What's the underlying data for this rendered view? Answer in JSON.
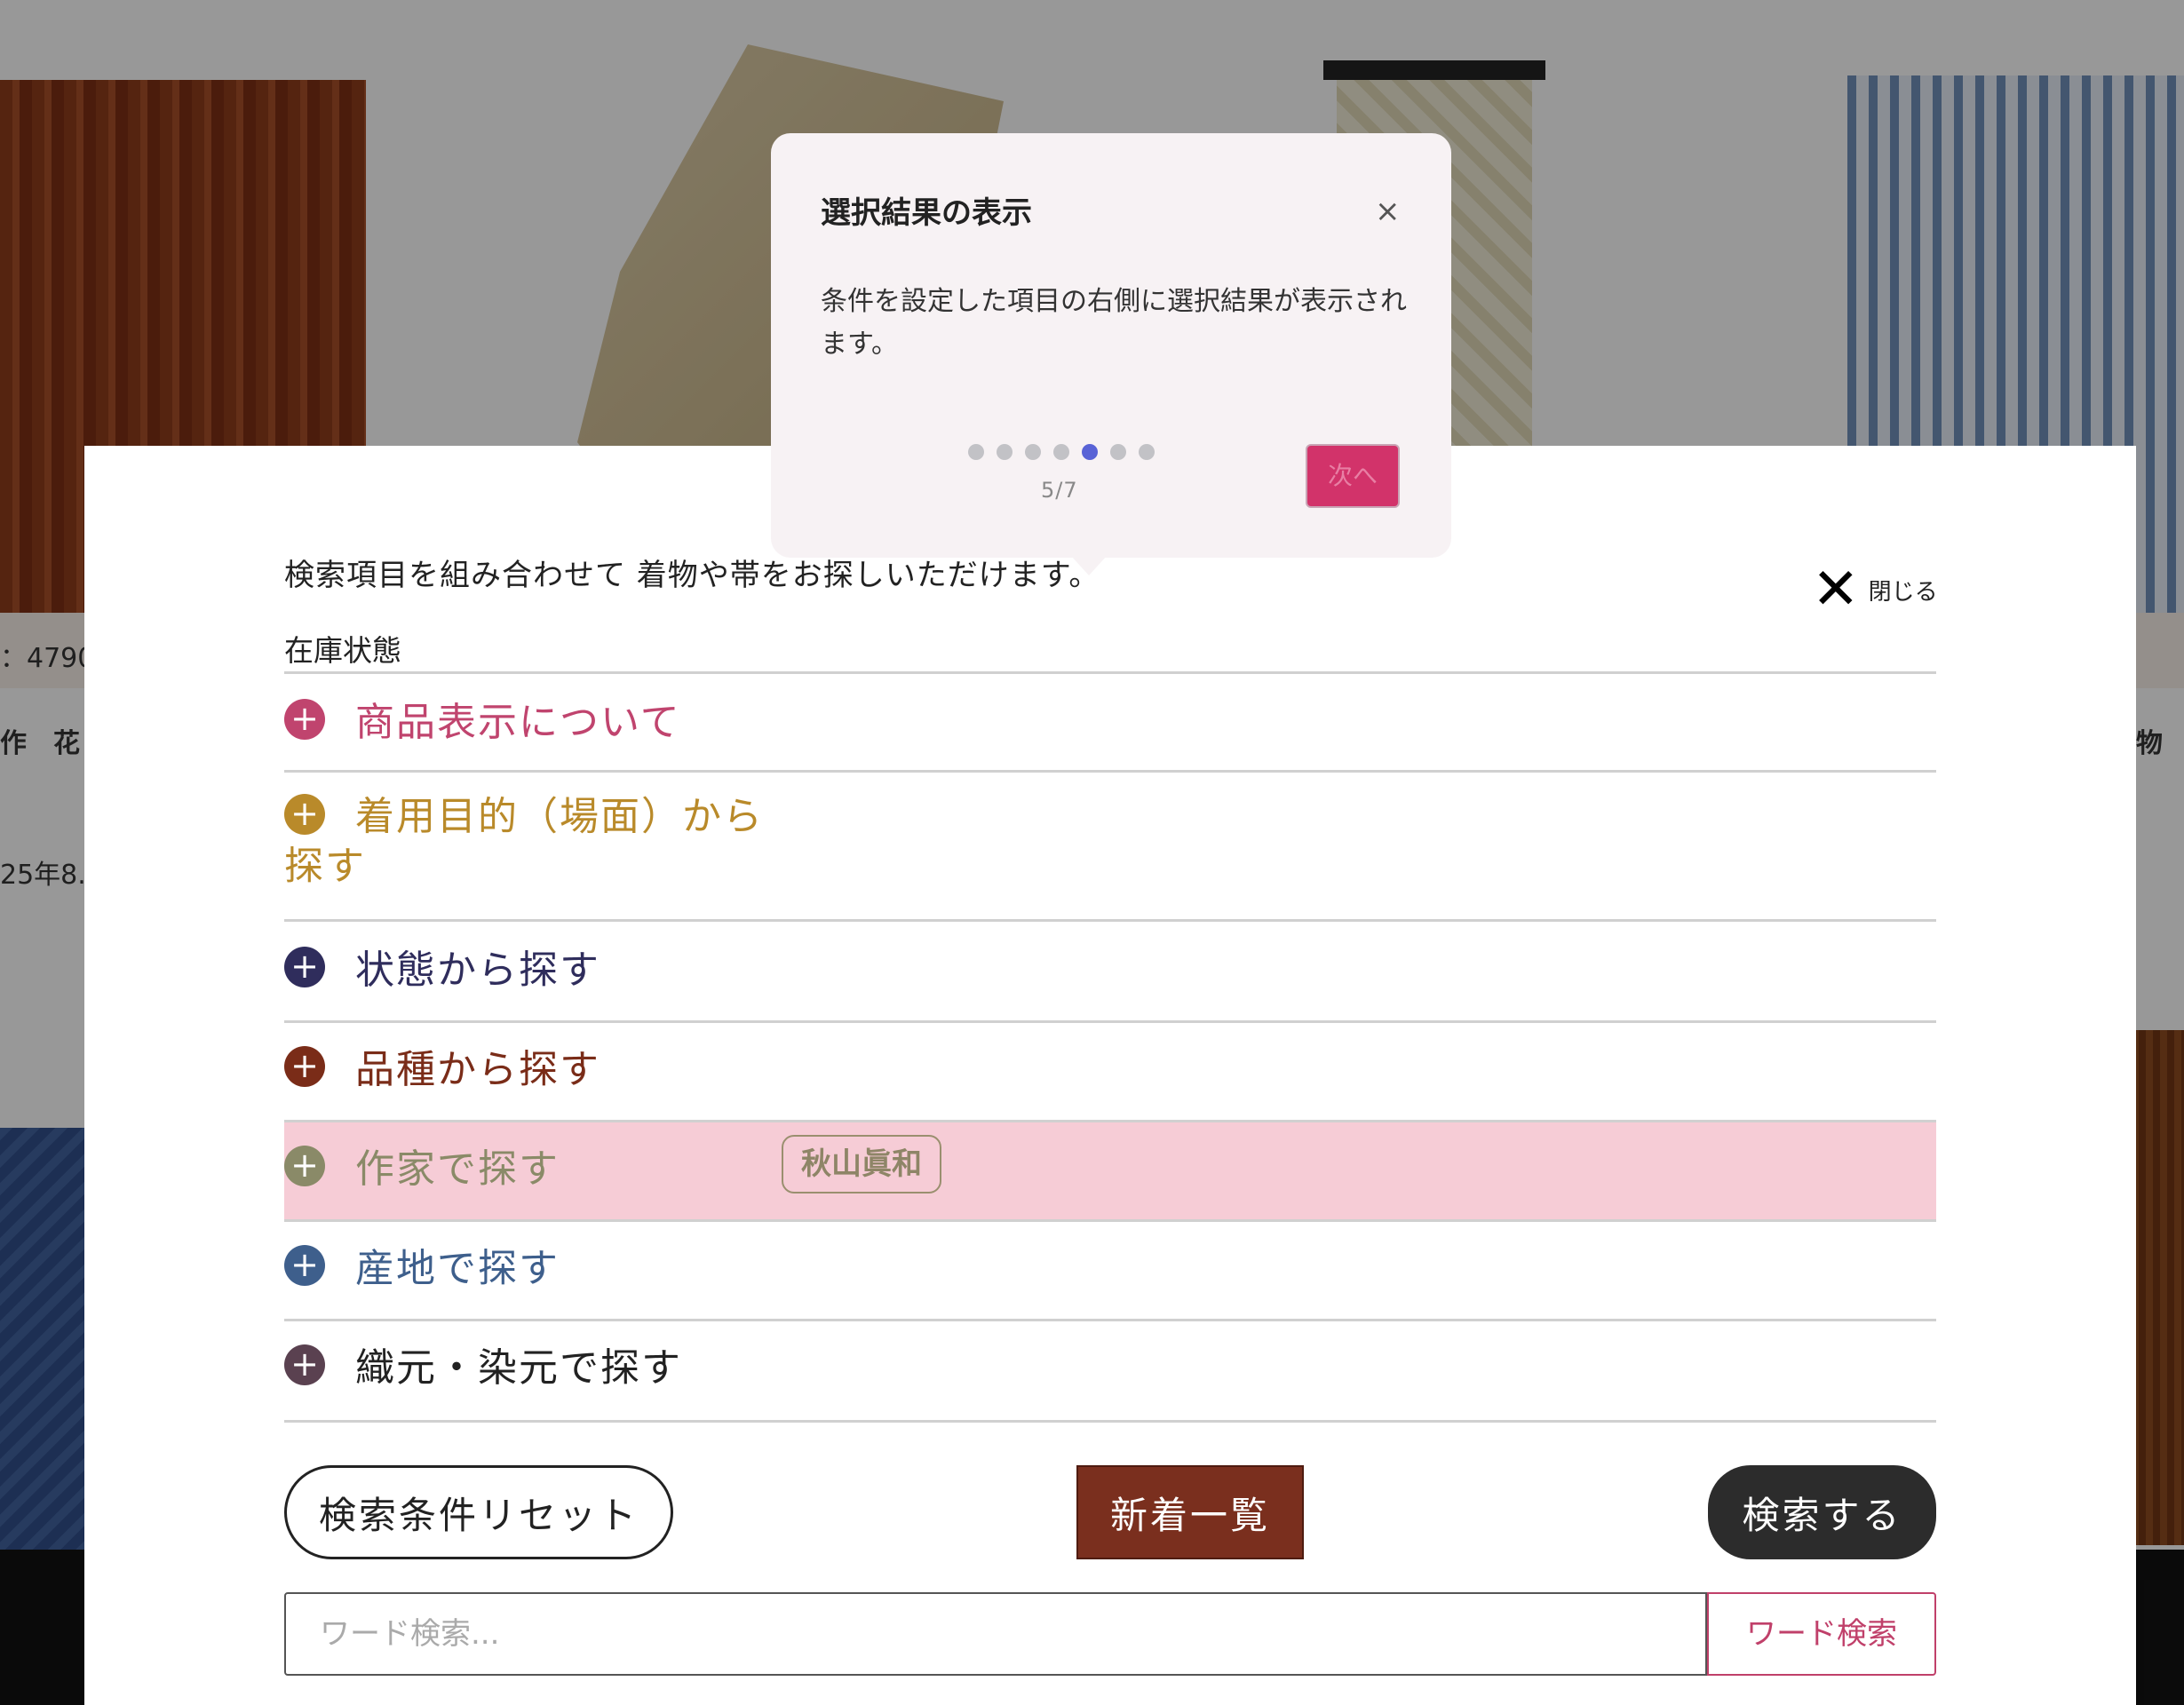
{
  "background": {
    "stock_text": "：4790",
    "title_fragment": "作　花",
    "date_fragment": "25年8.",
    "right_fragment": "物"
  },
  "panel": {
    "intro": "検索項目を組み合わせて 着物や帯をお探しいただけます。",
    "close_label": "閉じる",
    "stock_label": "在庫状態"
  },
  "accordion": [
    {
      "label": "商品表示について",
      "color": "#c0446e"
    },
    {
      "label": "着用目的（場面）から探す",
      "color": "#b98a2a"
    },
    {
      "label": "状態から探す",
      "color": "#2f2d5c"
    },
    {
      "label": "品種から探す",
      "color": "#7a2c18"
    },
    {
      "label": "作家で探す",
      "color": "#8a8a68",
      "selected": "秋山眞和",
      "highlight": "#f6ccd6"
    },
    {
      "label": "産地で探す",
      "color": "#3e5f8c"
    },
    {
      "label": "織元・染元で探す",
      "color": "#5a4150"
    }
  ],
  "buttons": {
    "reset": "検索条件リセット",
    "new_list": "新着一覧",
    "search": "検索する"
  },
  "word_search": {
    "placeholder": "ワード検索...",
    "button": "ワード検索"
  },
  "tooltip": {
    "title": "選択結果の表示",
    "close": "×",
    "body": "条件を設定した項目の右側に選択結果が表示されます。",
    "step_current": 5,
    "step_total": 7,
    "counter": "5/7",
    "next": "次へ"
  }
}
